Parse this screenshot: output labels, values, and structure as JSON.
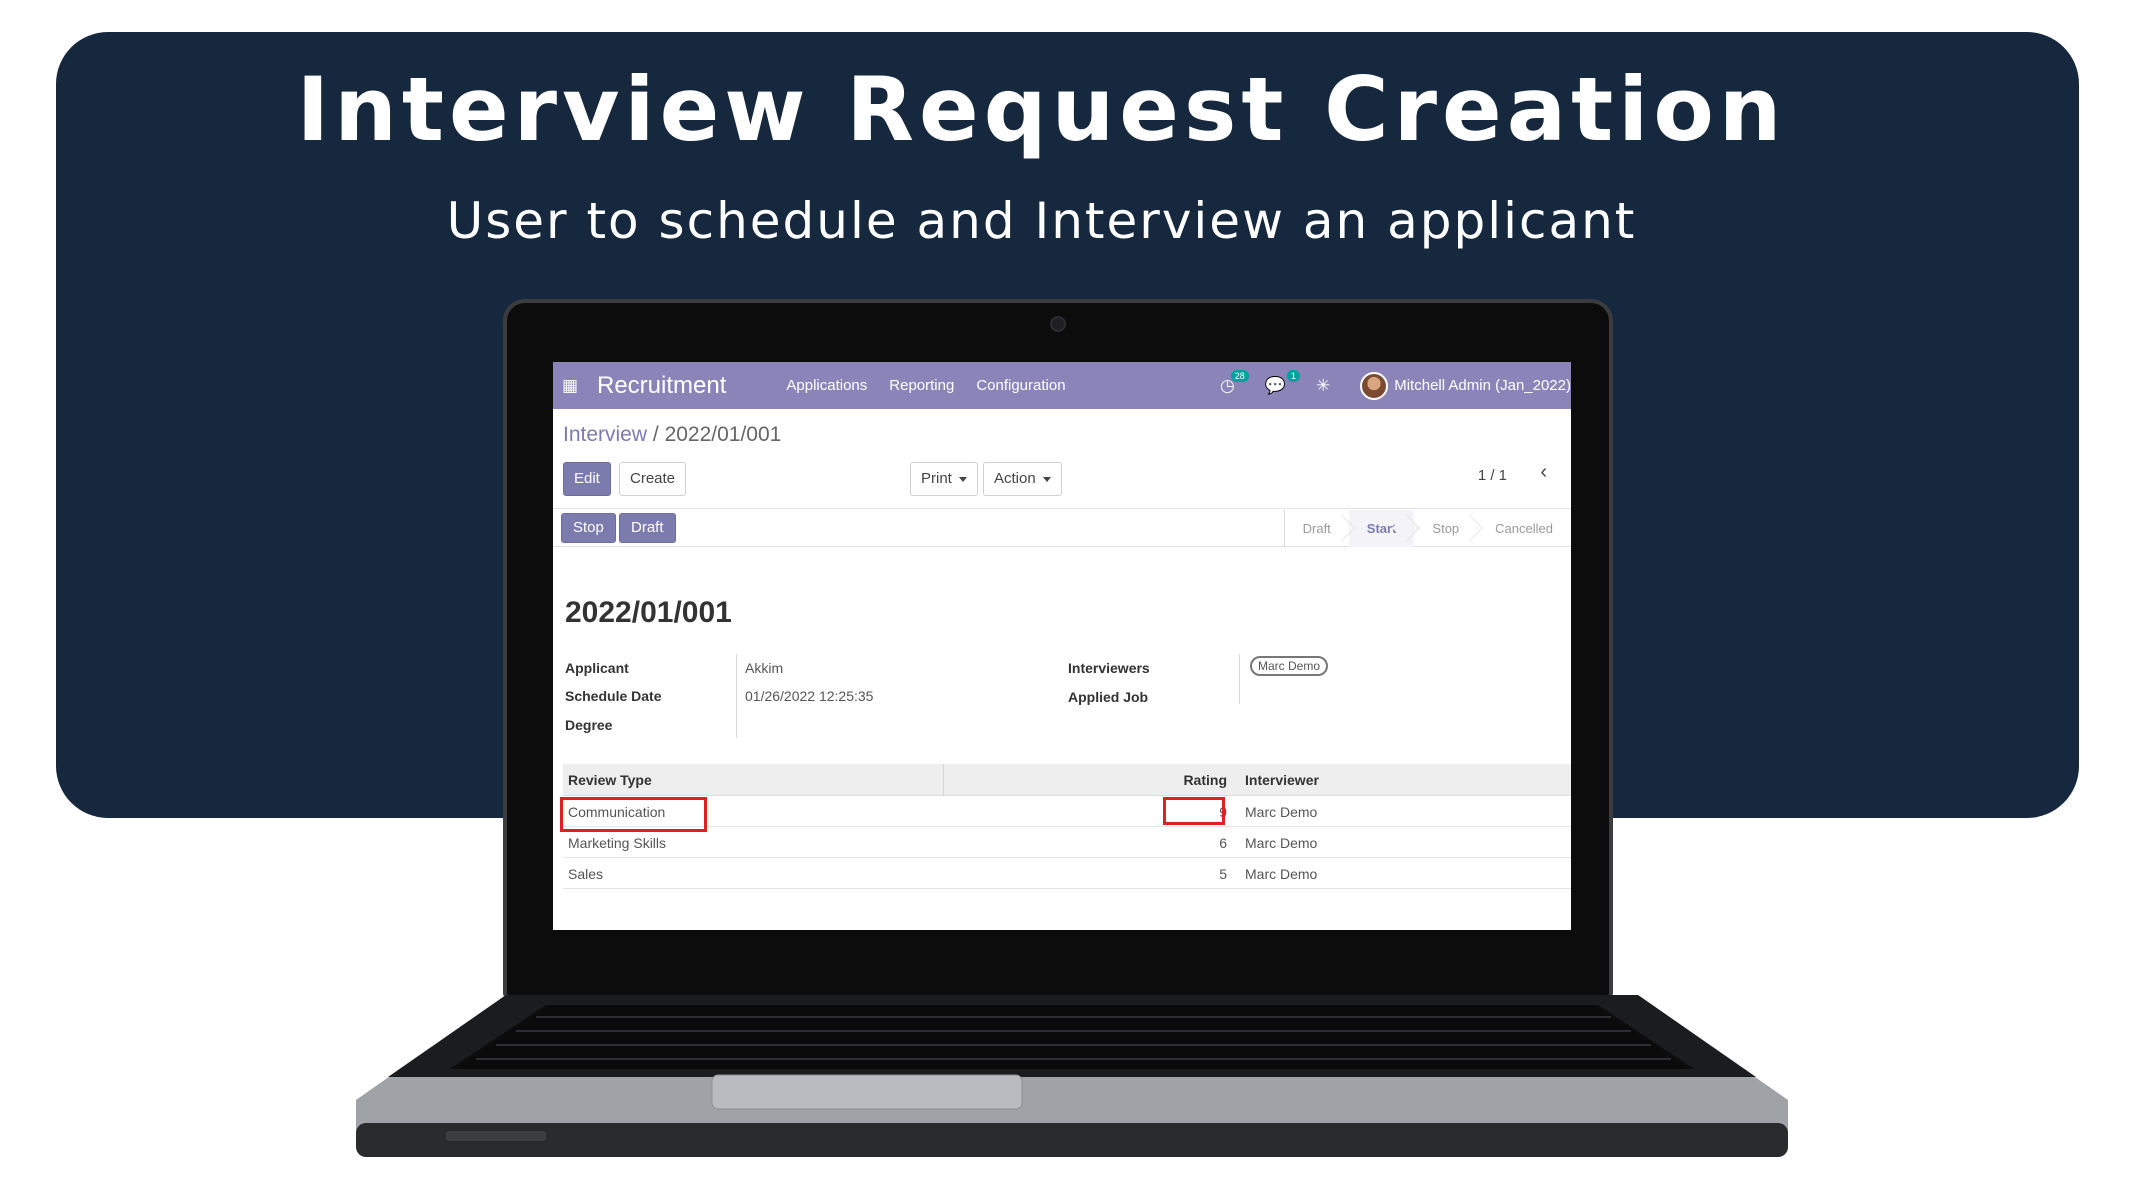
{
  "banner": {
    "title": "Interview Request Creation",
    "subtitle": "User to schedule and Interview an applicant"
  },
  "navbar": {
    "app_name": "Recruitment",
    "menu": [
      "Applications",
      "Reporting",
      "Configuration"
    ],
    "activity_count": "28",
    "message_count": "1",
    "user_name": "Mitchell Admin (Jan_2022)"
  },
  "breadcrumb": {
    "parent": "Interview",
    "separator": "/",
    "current": "2022/01/001"
  },
  "toolbar": {
    "edit": "Edit",
    "create": "Create",
    "print": "Print",
    "action": "Action",
    "pager": "1 / 1"
  },
  "statusbar": {
    "buttons": [
      "Stop",
      "Draft"
    ],
    "stages": [
      "Draft",
      "Start",
      "Stop",
      "Cancelled"
    ],
    "active_stage": "Start"
  },
  "record": {
    "name": "2022/01/001",
    "applicant_label": "Applicant",
    "applicant_value": "Akkim",
    "schedule_label": "Schedule Date",
    "schedule_value": "01/26/2022 12:25:35",
    "degree_label": "Degree",
    "interviewers_label": "Interviewers",
    "interviewer_tag": "Marc Demo",
    "applied_job_label": "Applied Job"
  },
  "reviews": {
    "headers": [
      "Review Type",
      "Rating",
      "Interviewer"
    ],
    "rows": [
      {
        "type": "Communication",
        "rating": "9",
        "interviewer": "Marc Demo"
      },
      {
        "type": "Marketing Skills",
        "rating": "6",
        "interviewer": "Marc Demo"
      },
      {
        "type": "Sales",
        "rating": "5",
        "interviewer": "Marc Demo"
      }
    ]
  },
  "colors": {
    "banner": "#16283d",
    "navbar": "#8a84b9",
    "primary": "#7c7bad",
    "highlight": "#e01f1f"
  }
}
